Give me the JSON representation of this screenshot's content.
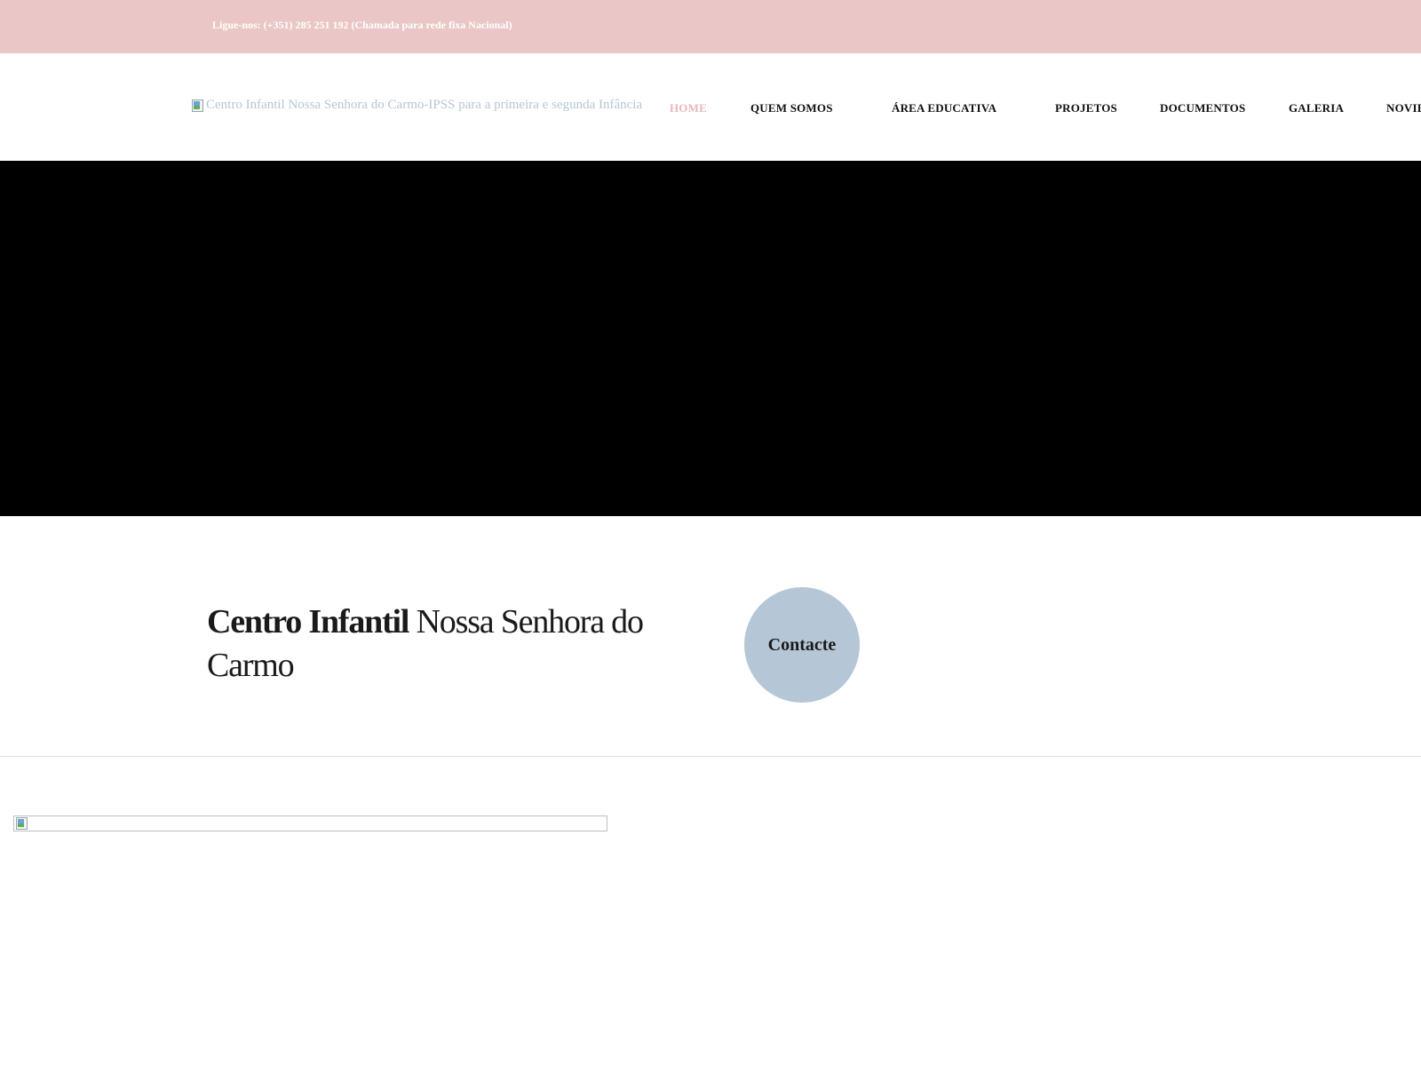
{
  "topbar": {
    "phone_text": "Ligue-nos: (+351) 285 251 192 (Chamada para rede fixa Nacional)"
  },
  "header": {
    "logo_alt": "Centro Infantil Nossa Senhora do Carmo-IPSS para a primeira e segunda Infância",
    "nav": [
      {
        "label": "HOME",
        "active": true
      },
      {
        "label": "QUEM SOMOS",
        "active": false
      },
      {
        "label": "ÁREA EDUCATIVA",
        "active": false
      },
      {
        "label": "PROJETOS",
        "active": false
      },
      {
        "label": "DOCUMENTOS",
        "active": false
      },
      {
        "label": "GALERIA",
        "active": false
      },
      {
        "label": "NOVID",
        "active": false
      }
    ]
  },
  "intro": {
    "title_bold": "Centro Infantil",
    "title_rest": " Nossa Senhora do Carmo",
    "contact_button": "Contacte"
  },
  "colors": {
    "topbar_bg": "#ebc6c6",
    "accent_pink": "#e7b8bb",
    "accent_blue": "#b5c7d6",
    "hero_bg": "#000000"
  },
  "icons": {
    "logo_image": "broken-image-icon",
    "content_image": "broken-image-icon"
  }
}
